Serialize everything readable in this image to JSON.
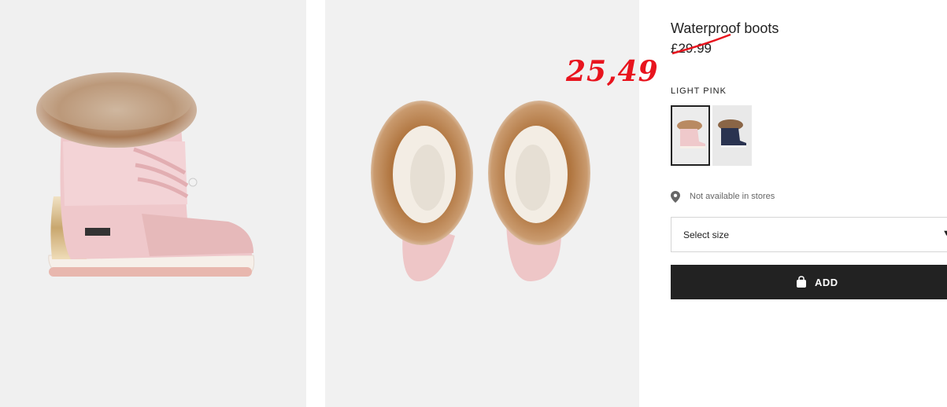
{
  "product": {
    "title": "Waterproof boots",
    "old_price": "£29.99",
    "sale_price": "25,49",
    "color_label": "LIGHT PINK"
  },
  "images": {
    "main_side": "boot-side-image",
    "main_top": "boots-top-image"
  },
  "swatches": [
    {
      "name": "light-pink",
      "selected": true
    },
    {
      "name": "navy",
      "selected": false
    }
  ],
  "availability": {
    "text": "Not available in stores",
    "icon": "location-pin-icon"
  },
  "size_select": {
    "label": "Select size",
    "icon": "chevron-down-icon"
  },
  "add_button": {
    "label": "ADD",
    "icon": "shopping-bag-icon"
  },
  "colors": {
    "sale": "#e8141e",
    "button": "#222222",
    "boot_pink": "#efc9cb",
    "fur_brown": "#b98050"
  }
}
